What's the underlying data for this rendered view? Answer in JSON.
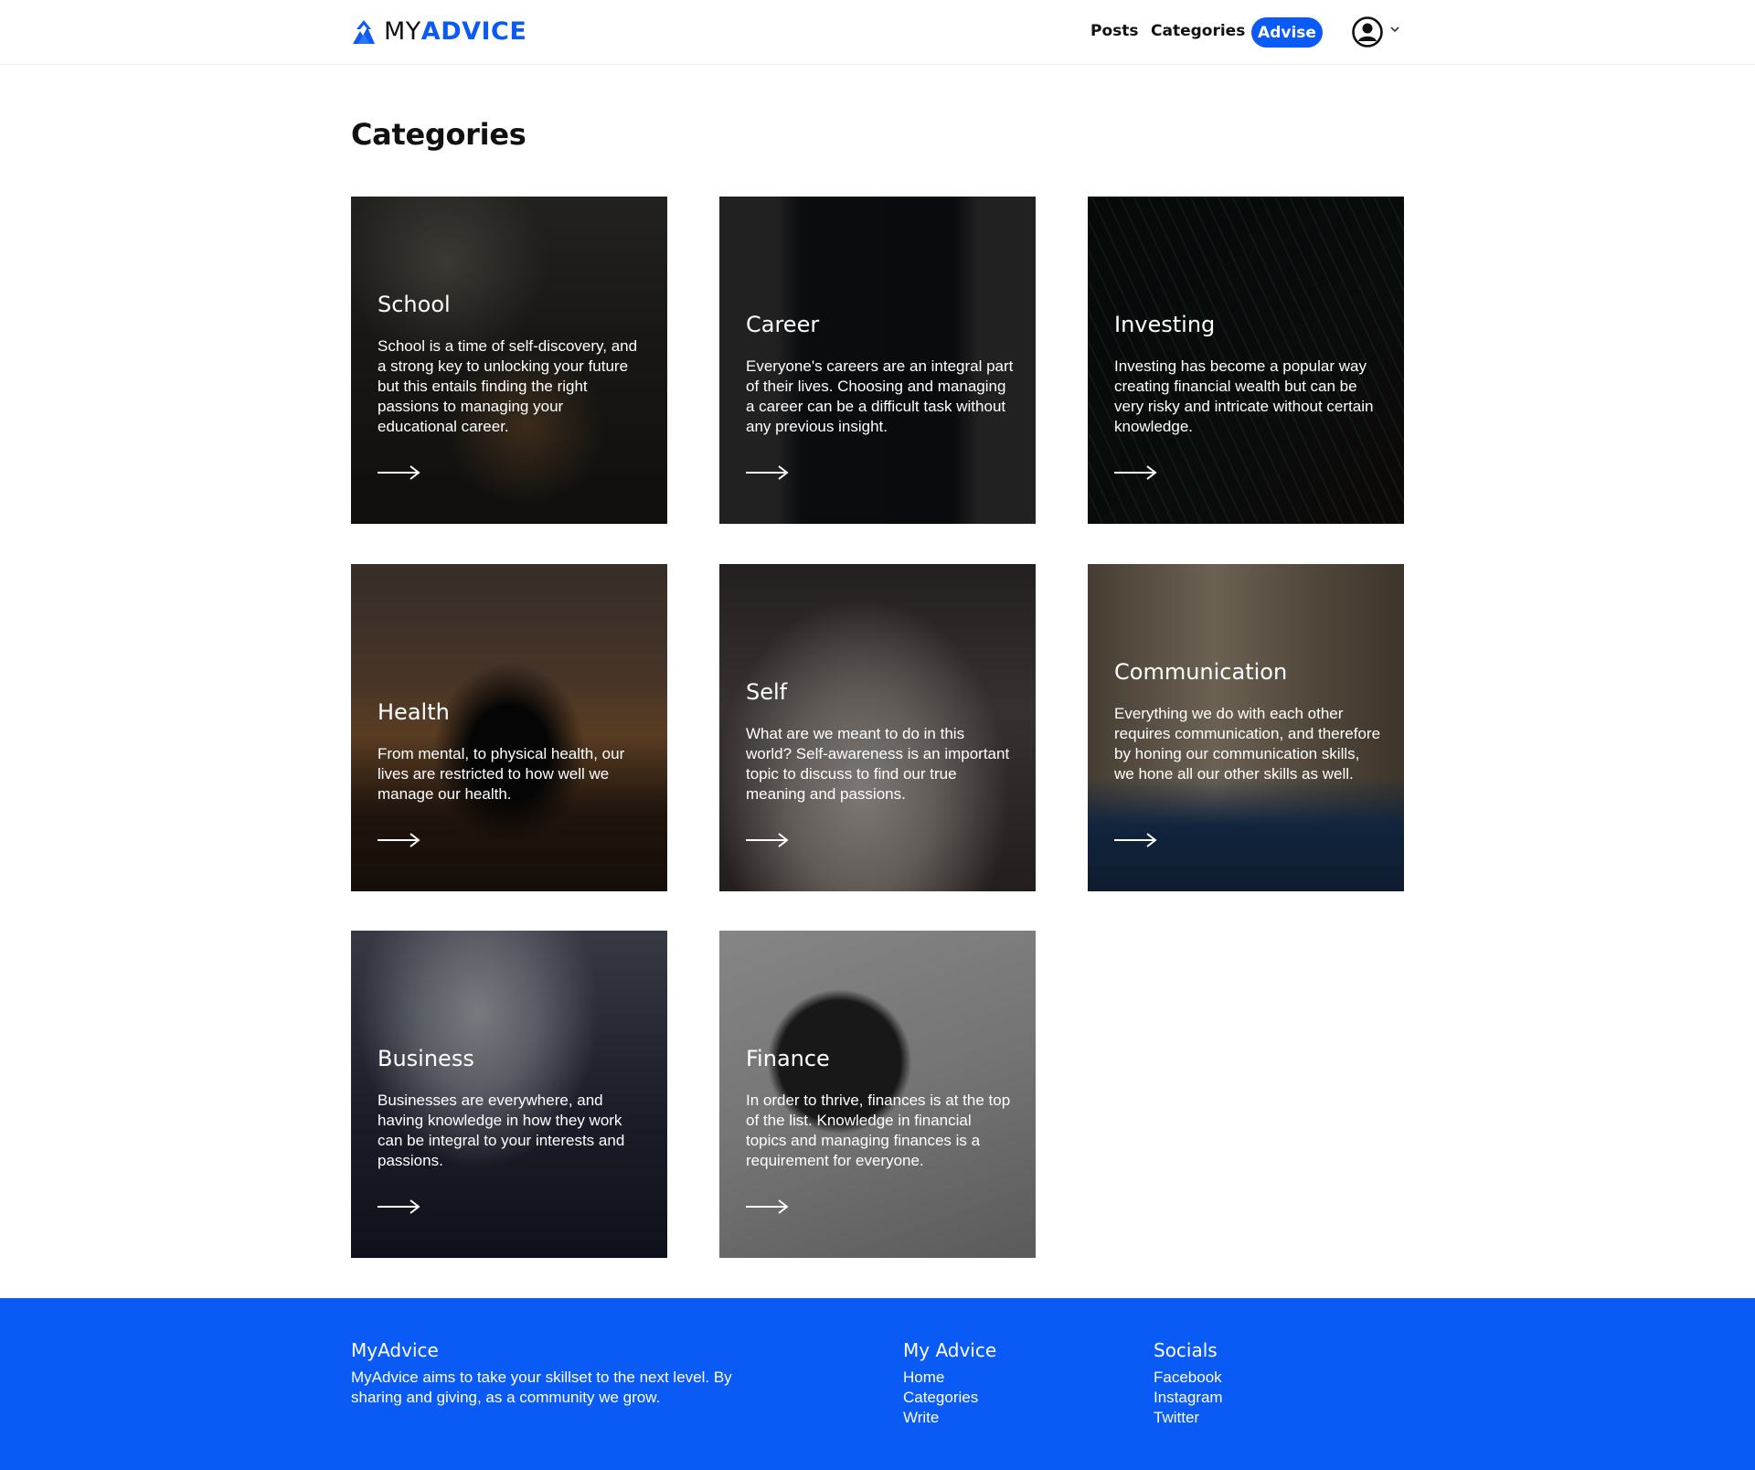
{
  "brand": {
    "name_prefix": "MY",
    "name_suffix": "ADVICE",
    "accent_color": "#0a5af5"
  },
  "nav": {
    "posts": "Posts",
    "categories": "Categories",
    "advise": "Advise"
  },
  "main": {
    "title": "Categories",
    "categories": [
      {
        "title": "School",
        "description": "School is a time of self-discovery, and a strong key to unlocking your future but this entails finding the right passions to managing your educational career."
      },
      {
        "title": "Career",
        "description": "Everyone's careers are an integral part of their lives. Choosing and managing a career can be a difficult task without any previous insight."
      },
      {
        "title": "Investing",
        "description": "Investing has become a popular way creating financial wealth but can be very risky and intricate without certain knowledge."
      },
      {
        "title": "Health",
        "description": "From mental, to physical health, our lives are restricted to how well we manage our health."
      },
      {
        "title": "Self",
        "description": "What are we meant to do in this world? Self-awareness is an important topic to discuss to find our true meaning and passions."
      },
      {
        "title": "Communication",
        "description": "Everything we do with each other requires communication, and therefore by honing our communication skills, we hone all our other skills as well."
      },
      {
        "title": "Business",
        "description": "Businesses are everywhere, and having knowledge in how they work can be integral to your interests and passions."
      },
      {
        "title": "Finance",
        "description": "In order to thrive, finances is at the top of the list. Knowledge in financial topics and managing finances is a requirement for everyone."
      }
    ]
  },
  "footer": {
    "about": {
      "heading": "MyAdvice",
      "text": "MyAdvice aims to take your skillset to the next level. By sharing and giving, as a community we grow."
    },
    "site": {
      "heading": "My Advice",
      "links": [
        "Home",
        "Categories",
        "Write"
      ]
    },
    "socials": {
      "heading": "Socials",
      "links": [
        "Facebook",
        "Instagram",
        "Twitter"
      ]
    }
  },
  "icons": {
    "logo": "myadvice-logo-icon",
    "user": "user-circle-icon",
    "dropdown": "chevron-down-icon",
    "card_arrow": "arrow-right-icon"
  }
}
